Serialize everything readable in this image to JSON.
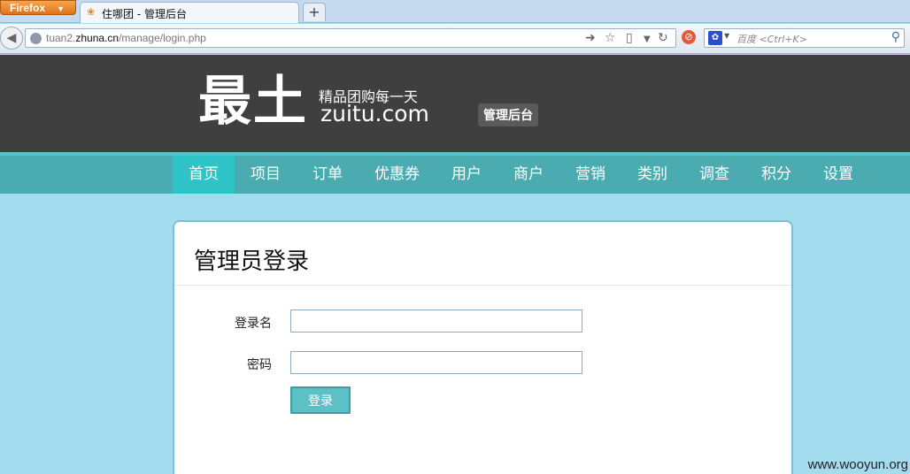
{
  "browser": {
    "menu_button": "Firefox",
    "tab_title": "住哪团 - 管理后台",
    "new_tab": "+",
    "url_prefix": "tuan2.",
    "url_domain": "zhuna.cn",
    "url_path": "/manage/login.php",
    "search_placeholder": "百度 <Ctrl+K>"
  },
  "header": {
    "logo_text": "最土",
    "slogan": "精品团购每一天",
    "domain": "zuitu.com",
    "admin_badge": "管理后台"
  },
  "nav": {
    "items": [
      "首页",
      "项目",
      "订单",
      "优惠券",
      "用户",
      "商户",
      "营销",
      "类别",
      "调查",
      "积分",
      "设置"
    ],
    "active_index": 0
  },
  "login": {
    "title": "管理员登录",
    "username_label": "登录名",
    "username_value": "",
    "password_label": "密码",
    "password_value": "",
    "submit_label": "登录"
  },
  "watermark": "www.wooyun.org",
  "colors": {
    "background": "#a3dcef",
    "header": "#3f3f3f",
    "nav": "#4aabb0",
    "nav_active": "#2ec3c6",
    "button": "#5cc0c7"
  }
}
